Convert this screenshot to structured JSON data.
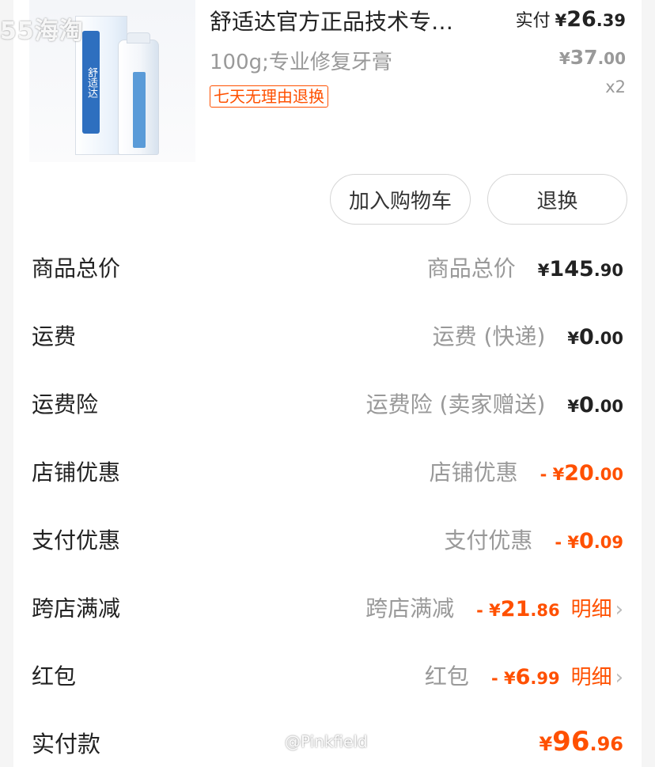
{
  "watermark_logo": "55海淘",
  "watermark_user": "@Pinkfield",
  "product": {
    "brand_text": "舒适达",
    "title": "舒适达官方正品技术专…",
    "sku": "100g;专业修复牙膏",
    "tag": "七天无理由退换",
    "paid_label": "实付",
    "paid_currency": "¥",
    "paid_int": "26",
    "paid_dec": ".39",
    "orig_currency": "¥",
    "orig_int": "37",
    "orig_dec": ".00",
    "qty": "x2"
  },
  "buttons": {
    "cart": "加入购物车",
    "return": "退换"
  },
  "summary": [
    {
      "label": "商品总价",
      "desc": "商品总价",
      "prefix": "¥",
      "int": "145",
      "dec": ".90"
    },
    {
      "label": "运费",
      "desc": "运费 (快递)",
      "prefix": "¥",
      "int": "0",
      "dec": ".00"
    },
    {
      "label": "运费险",
      "desc": "运费险 (卖家赠送)",
      "prefix": "¥",
      "int": "0",
      "dec": ".00"
    },
    {
      "label": "店铺优惠",
      "desc": "店铺优惠",
      "prefix": "- ¥",
      "int": "20",
      "dec": ".00"
    },
    {
      "label": "支付优惠",
      "desc": "支付优惠",
      "prefix": "- ¥",
      "int": "0",
      "dec": ".09"
    },
    {
      "label": "跨店满减",
      "desc": "跨店满减",
      "prefix": "- ¥",
      "int": "21",
      "dec": ".86",
      "detail": "明细"
    },
    {
      "label": "红包",
      "desc": "红包",
      "prefix": "- ¥",
      "int": "6",
      "dec": ".99",
      "detail": "明细"
    }
  ],
  "total": {
    "label": "实付款",
    "prefix": "¥",
    "int": "96",
    "dec": ".96"
  },
  "colors": {
    "accent": "#ff5000",
    "muted": "#999999",
    "text": "#222222"
  }
}
